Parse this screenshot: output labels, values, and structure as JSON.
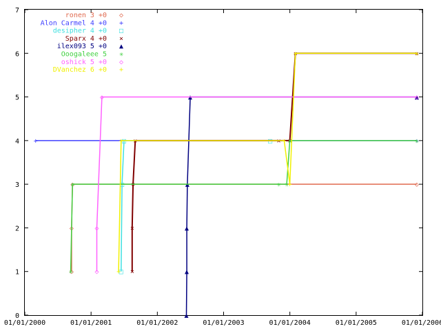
{
  "chart_data": {
    "type": "line",
    "title": "",
    "xlabel": "",
    "ylabel": "",
    "grid": false,
    "legend_placement": "top-left",
    "x_ticks": [
      "01/01/2000",
      "01/01/2001",
      "01/01/2002",
      "01/01/2003",
      "01/01/2004",
      "01/01/2005",
      "01/01/2006"
    ],
    "xlim": [
      "2000-01-01",
      "2006-01-01"
    ],
    "ylim": [
      0,
      7
    ],
    "y_ticks": [
      "0",
      "1",
      "2",
      "3",
      "4",
      "5",
      "6",
      "7"
    ],
    "series": [
      {
        "name": "ronen 3 +0",
        "color": "#e06a4f",
        "marker": "◇",
        "points": [
          [
            "2000-09-15",
            1
          ],
          [
            "2000-09-15",
            2
          ],
          [
            "2000-09-20",
            3
          ],
          [
            "2005-12-01",
            3
          ]
        ]
      },
      {
        "name": "Alon Carmel 4 +0",
        "color": "#4040ff",
        "marker": "+",
        "points": [
          [
            "2000-03-01",
            4
          ],
          [
            "2005-12-01",
            4
          ]
        ]
      },
      {
        "name": "desipher 4 +0",
        "color": "#40e0e0",
        "marker": "□",
        "points": [
          [
            "2001-06-15",
            1
          ],
          [
            "2001-06-20",
            3
          ],
          [
            "2001-07-01",
            4
          ],
          [
            "2003-09-15",
            4
          ]
        ]
      },
      {
        "name": "Sparx 4 +0",
        "color": "#800000",
        "marker": "×",
        "points": [
          [
            "2001-08-15",
            1
          ],
          [
            "2001-08-15",
            2
          ],
          [
            "2001-08-20",
            3
          ],
          [
            "2001-09-01",
            4
          ],
          [
            "2003-11-01",
            4
          ],
          [
            "2004-01-01",
            4
          ],
          [
            "2004-02-01",
            6
          ],
          [
            "2005-12-01",
            6
          ]
        ]
      },
      {
        "name": "ilex093 5 +0",
        "color": "#000080",
        "marker": "▲",
        "points": [
          [
            "2002-06-10",
            0
          ],
          [
            "2002-06-12",
            1
          ],
          [
            "2002-06-12",
            2
          ],
          [
            "2002-06-15",
            3
          ],
          [
            "2002-07-01",
            5
          ],
          [
            "2005-12-01",
            5
          ]
        ]
      },
      {
        "name": "Ooogaleee 5",
        "color": "#40d040",
        "marker": "✳",
        "points": [
          [
            "2000-09-10",
            1
          ],
          [
            "2000-09-20",
            3
          ],
          [
            "2003-11-01",
            3
          ],
          [
            "2003-12-15",
            3
          ],
          [
            "2004-01-01",
            4
          ],
          [
            "2005-12-01",
            4
          ]
        ]
      },
      {
        "name": "oshick 5 +0",
        "color": "#ff60ff",
        "marker": "◇",
        "points": [
          [
            "2001-02-01",
            1
          ],
          [
            "2001-02-01",
            2
          ],
          [
            "2001-03-01",
            5
          ],
          [
            "2005-12-01",
            5
          ]
        ]
      },
      {
        "name": "DVanchez 6 +0",
        "color": "#f0f000",
        "marker": "+",
        "points": [
          [
            "2001-06-01",
            1
          ],
          [
            "2001-06-15",
            4
          ],
          [
            "2003-12-01",
            4
          ],
          [
            "2004-01-01",
            3
          ],
          [
            "2004-02-01",
            6
          ],
          [
            "2005-12-01",
            6
          ]
        ]
      }
    ]
  }
}
